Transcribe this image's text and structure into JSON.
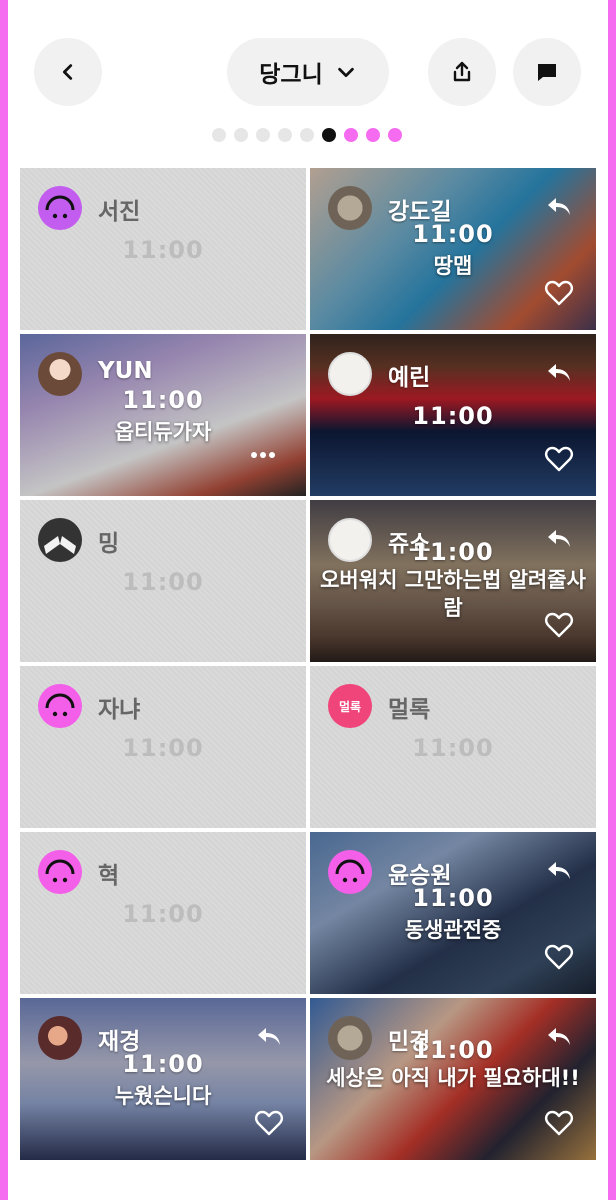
{
  "header": {
    "title": "당그니"
  },
  "pagination": {
    "total": 9,
    "active_index": 5,
    "dots": [
      "gray",
      "gray",
      "gray",
      "gray",
      "gray",
      "active",
      "pink",
      "pink",
      "pink"
    ]
  },
  "colors": {
    "accent_pink": "#f56cf0",
    "dot_active": "#111111",
    "dot_inactive": "#e6e6e6"
  },
  "tiles": [
    {
      "name": "서진",
      "time": "11:00",
      "caption": "",
      "posted": false,
      "avatar": "smiley-purple"
    },
    {
      "name": "강도길",
      "time": "11:00",
      "caption": "땅맵",
      "posted": true,
      "avatar": "photo"
    },
    {
      "name": "YUN",
      "time": "11:00",
      "caption": "옵티듀가자",
      "posted": true,
      "avatar": "photo"
    },
    {
      "name": "예린",
      "time": "11:00",
      "caption": "",
      "posted": true,
      "avatar": "photo"
    },
    {
      "name": "밍",
      "time": "11:00",
      "caption": "",
      "posted": false,
      "avatar": "dark"
    },
    {
      "name": "쥬쇼",
      "time": "11:00",
      "caption": "오버워치 그만하는법 알려줄사람",
      "posted": true,
      "avatar": "photo"
    },
    {
      "name": "자냐",
      "time": "11:00",
      "caption": "",
      "posted": false,
      "avatar": "smiley-pink"
    },
    {
      "name": "멀록",
      "time": "11:00",
      "caption": "",
      "posted": false,
      "avatar": "text",
      "avatar_text": "멀록"
    },
    {
      "name": "혁",
      "time": "11:00",
      "caption": "",
      "posted": false,
      "avatar": "smiley-pink"
    },
    {
      "name": "윤승원",
      "time": "11:00",
      "caption": "동생관전중",
      "posted": true,
      "avatar": "smiley-pink"
    },
    {
      "name": "재경",
      "time": "11:00",
      "caption": "누웠슨니다",
      "posted": true,
      "avatar": "photo"
    },
    {
      "name": "민경",
      "time": "11:00",
      "caption": "세상은 아직 내가 필요하대!!",
      "posted": true,
      "avatar": "photo"
    }
  ]
}
